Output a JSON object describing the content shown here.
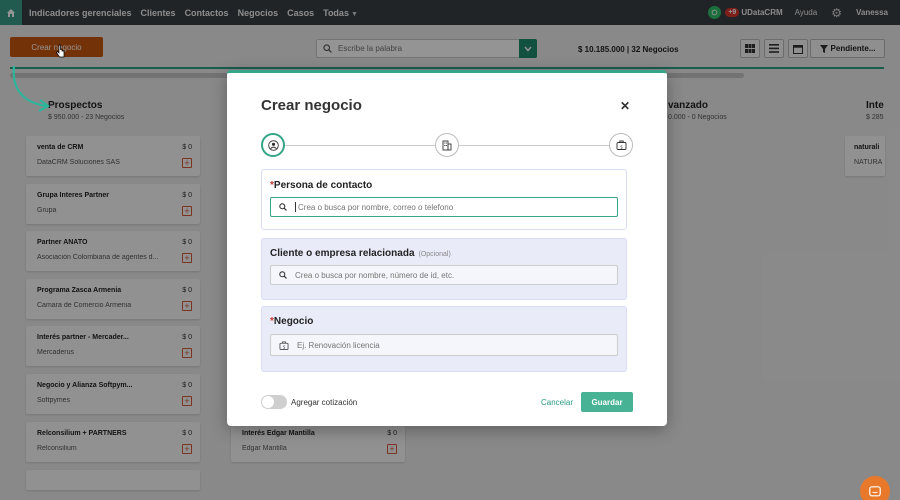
{
  "nav": {
    "items": [
      "Indicadores gerenciales",
      "Clientes",
      "Contactos",
      "Negocios",
      "Casos",
      "Todas"
    ],
    "notif_count": "+9",
    "brand": "UDataCRM",
    "help": "Ayuda",
    "user": "Vanessa"
  },
  "toolbar": {
    "create_label": "Crear negocio",
    "search_placeholder": "Escribe la palabra",
    "totals": "$ 10.185.000 | 32 Negocios",
    "filter_label": "Pendiente..."
  },
  "board": {
    "col1": {
      "title": "Prospectos",
      "sub": "$ 950.000 - 23 Negocios"
    },
    "col2": {
      "title": "vanzado",
      "sub": "0.000 - 0 Negocios"
    },
    "col3": {
      "title": "Inte",
      "sub": "$ 285"
    },
    "col1_cards": [
      {
        "title": "venta de CRM",
        "amount": "$ 0",
        "org": "DataCRM Soluciones SAS"
      },
      {
        "title": "Grupa Interes Partner",
        "amount": "$ 0",
        "org": "Grupa"
      },
      {
        "title": "Partner ANATO",
        "amount": "$ 0",
        "org": "Asociación Colombiana de agentes d..."
      },
      {
        "title": "Programa Zasca Armenia",
        "amount": "$ 0",
        "org": "Camara de Comercio Armenia"
      },
      {
        "title": "Interés partner - Mercader...",
        "amount": "$ 0",
        "org": "Mercaderus"
      },
      {
        "title": "Negocio y Alianza Softpym...",
        "amount": "$ 0",
        "org": "Softpymes"
      },
      {
        "title": "Relconsilium + PARTNERS",
        "amount": "$ 0",
        "org": "Relconsilium"
      }
    ],
    "col2_card": {
      "title": "Interés Edgar Mantilla",
      "amount": "$ 0",
      "org": "Edgar Mantilla"
    },
    "col3_card": {
      "title": "naturali",
      "org": "NATURA"
    }
  },
  "modal": {
    "title": "Crear negocio",
    "contact": {
      "label": "Persona de contacto",
      "placeholder": "Crea o busca por nombre, correo o telefono"
    },
    "company": {
      "label": "Cliente o empresa relacionada",
      "optional": "(Opcional)",
      "placeholder": "Crea o busca por nombre, número de id, etc."
    },
    "deal": {
      "label": "Negocio",
      "placeholder": "Ej. Renovación licencia"
    },
    "toggle_label": "Agregar cotización",
    "cancel": "Cancelar",
    "save": "Guardar"
  },
  "colors": {
    "accent": "#36a587",
    "create": "#c9570f",
    "required": "#d0342c",
    "nav": "#3a3f44"
  },
  "icons": [
    "home-icon",
    "search-icon",
    "whatsapp-icon",
    "gear-icon",
    "grid-view-icon",
    "list-view-icon",
    "calendar-icon",
    "filter-icon",
    "close-icon",
    "person-icon",
    "building-icon",
    "briefcase-icon",
    "chat-icon"
  ]
}
